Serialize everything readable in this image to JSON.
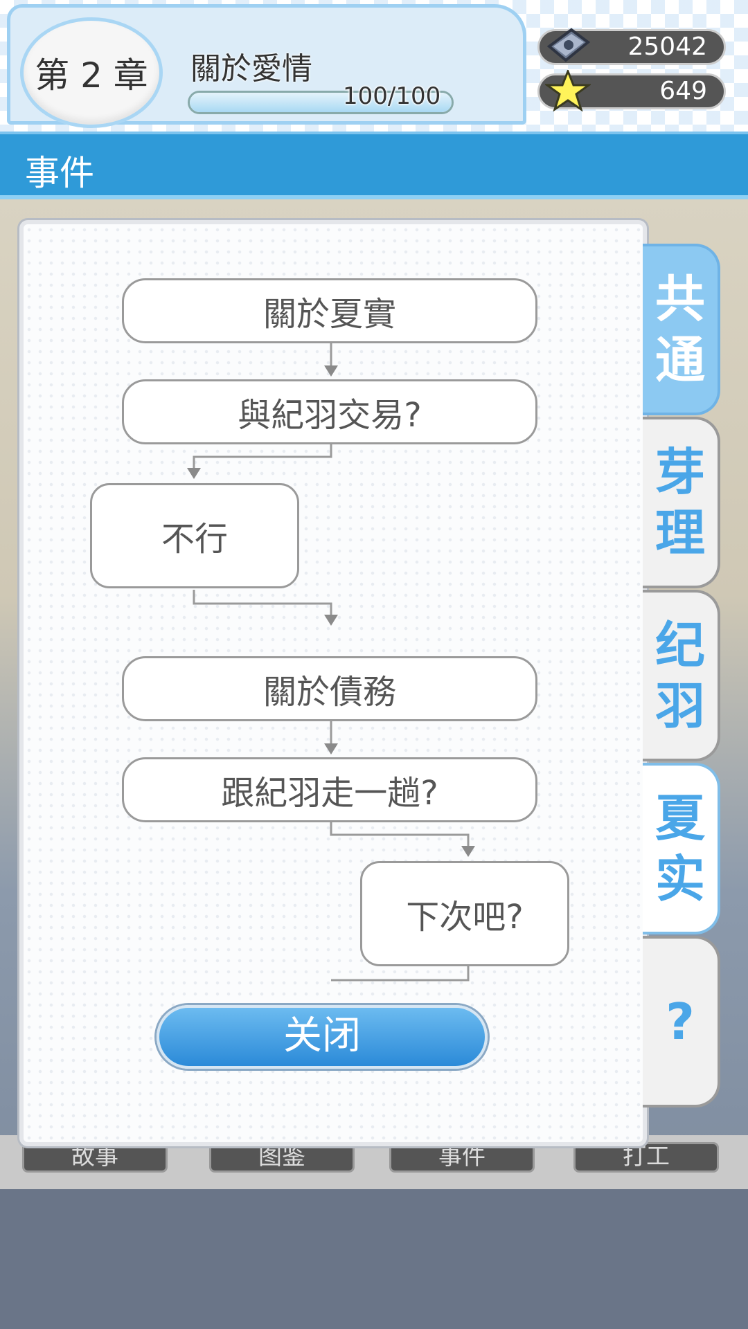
{
  "header": {
    "chapter_label": "第 2 章",
    "chapter_title": "關於愛情",
    "progress_text": "100/100",
    "progress_fraction": 1.0,
    "gems": "25042",
    "stars": "649"
  },
  "event_bar": {
    "title": "事件"
  },
  "bottom_nav": [
    "故事",
    "图鉴",
    "事件",
    "打工"
  ],
  "flowchart": {
    "nodes": [
      "關於夏實",
      "與紀羽交易?",
      "不行",
      "關於債務",
      "跟紀羽走一趟?",
      "下次吧?"
    ]
  },
  "close_label": "关闭",
  "tabs": [
    {
      "label_1": "共",
      "label_2": "通"
    },
    {
      "label_1": "芽",
      "label_2": "理"
    },
    {
      "label_1": "纪",
      "label_2": "羽"
    },
    {
      "label_1": "夏",
      "label_2": "实"
    },
    {
      "label_1": "?"
    }
  ],
  "colors": {
    "accent_blue": "#2f9ad8",
    "tab_text": "#4aa6e8",
    "node_border": "#9a9a9a"
  }
}
